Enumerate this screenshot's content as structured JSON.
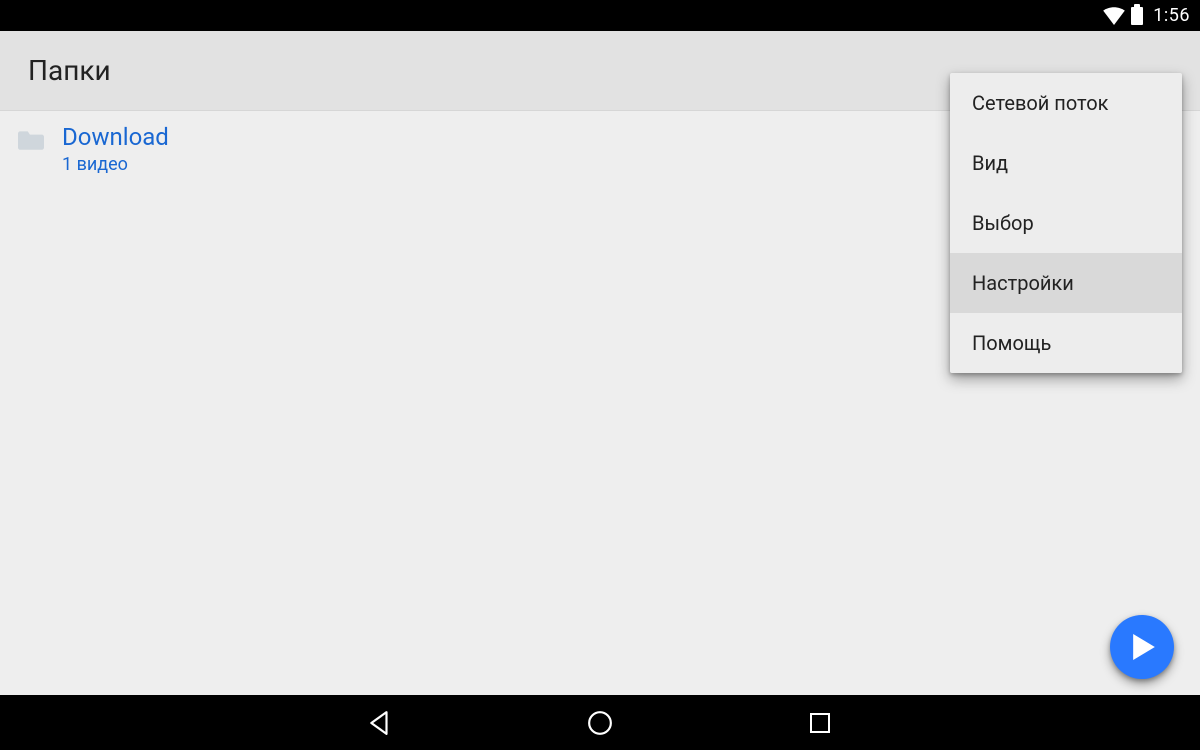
{
  "status": {
    "time": "1:56"
  },
  "header": {
    "title": "Папки"
  },
  "folder": {
    "name": "Download",
    "subtitle": "1 видео"
  },
  "menu": {
    "items": [
      {
        "label": "Сетевой поток"
      },
      {
        "label": "Вид"
      },
      {
        "label": "Выбор"
      },
      {
        "label": "Настройки"
      },
      {
        "label": "Помощь"
      }
    ],
    "highlighted_index": 3
  }
}
